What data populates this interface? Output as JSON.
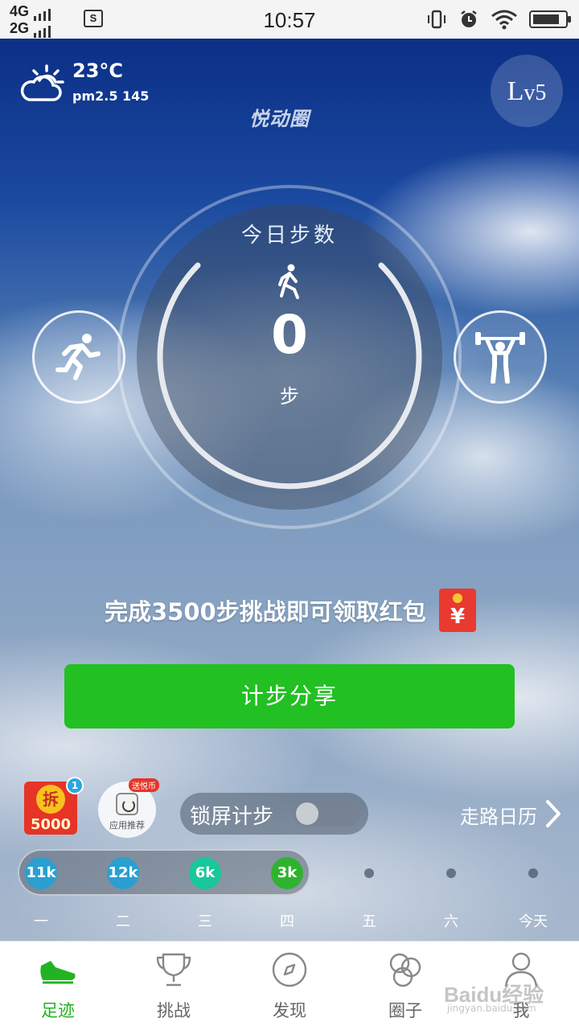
{
  "status_bar": {
    "net1": "4G",
    "net2": "2G",
    "sim_icon_text": "S",
    "time": "10:57",
    "battery_level": 0.85
  },
  "header": {
    "temperature": "23°C",
    "pm25": "pm2.5 145",
    "app_logo": "悦动圈",
    "level_prefix": "L",
    "level_suffix": "v5"
  },
  "dial": {
    "label": "今日步数",
    "step_count": "0",
    "unit": "步"
  },
  "challenge": {
    "text": "完成3500步挑战即可领取红包",
    "envelope_symbol": "¥"
  },
  "share_button": "计步分享",
  "widgets": {
    "chai_glyph": "拆",
    "chai_amount": "5000",
    "chai_badge": "1",
    "app_rec_tag": "送悦币",
    "app_rec_label": "应用推荐",
    "lock_screen_label": "锁屏计步",
    "lock_screen_on": false,
    "calendar_link": "走路日历"
  },
  "week": {
    "bubbles": [
      {
        "value": "11k",
        "color": "#2a9fd0"
      },
      {
        "value": "12k",
        "color": "#2a9fd0"
      },
      {
        "value": "6k",
        "color": "#18c79a"
      },
      {
        "value": "3k",
        "color": "#2fb32f"
      }
    ],
    "days": [
      "一",
      "二",
      "三",
      "四",
      "五",
      "六",
      "今天"
    ]
  },
  "tabs": [
    {
      "label": "足迹",
      "icon": "shoe-icon",
      "active": true
    },
    {
      "label": "挑战",
      "icon": "trophy-icon",
      "active": false
    },
    {
      "label": "发现",
      "icon": "compass-icon",
      "active": false
    },
    {
      "label": "圈子",
      "icon": "circles-icon",
      "active": false
    },
    {
      "label": "我",
      "icon": "person-icon",
      "active": false
    }
  ],
  "watermark": {
    "main": "Baidu经验",
    "sub": "jingyan.baidu.com"
  },
  "colors": {
    "accent_green": "#22c022",
    "red": "#e63426"
  }
}
